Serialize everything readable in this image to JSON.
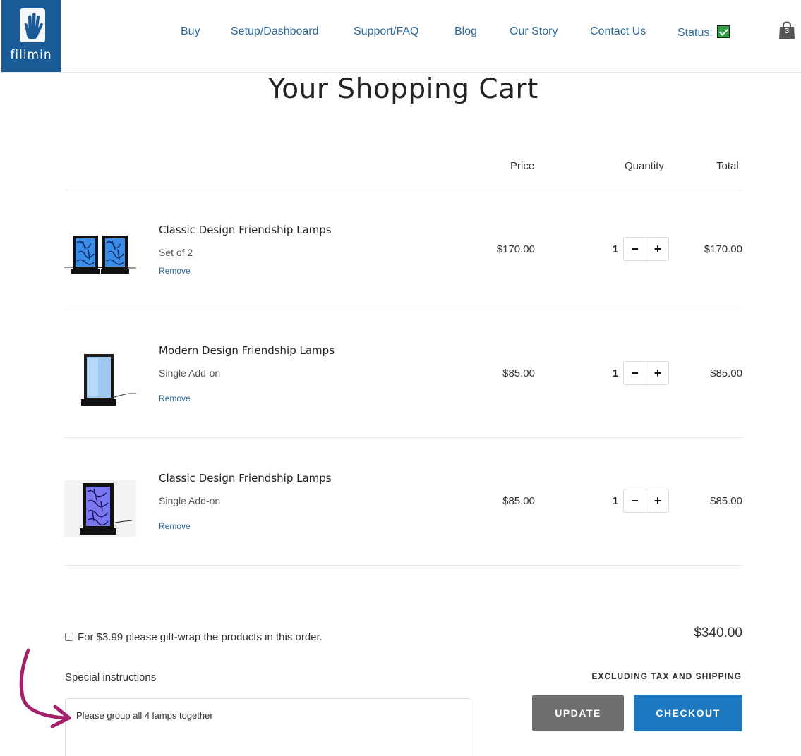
{
  "header": {
    "logo_text": "filimin",
    "nav": [
      {
        "label": "Buy"
      },
      {
        "label": "Setup/Dashboard"
      },
      {
        "label": "Support/FAQ"
      },
      {
        "label": "Blog"
      },
      {
        "label": "Our Story"
      },
      {
        "label": "Contact Us"
      },
      {
        "label": "Status:"
      }
    ],
    "status_color": "#2ea043",
    "cart_count": "3",
    "brand_color": "#1a5a96"
  },
  "page": {
    "title": "Your Shopping Cart"
  },
  "cart": {
    "columns": {
      "price": "Price",
      "quantity": "Quantity",
      "total": "Total"
    },
    "items": [
      {
        "name": "Classic Design Friendship Lamps",
        "variant": "Set of 2",
        "remove_label": "Remove",
        "price": "$170.00",
        "quantity": "1",
        "total": "$170.00",
        "thumb_icon": "classic-lamp-pair-image"
      },
      {
        "name": "Modern Design Friendship Lamps",
        "variant": "Single Add-on",
        "remove_label": "Remove",
        "price": "$85.00",
        "quantity": "1",
        "total": "$85.00",
        "thumb_icon": "modern-lamp-image"
      },
      {
        "name": "Classic Design Friendship Lamps",
        "variant": "Single Add-on",
        "remove_label": "Remove",
        "price": "$85.00",
        "quantity": "1",
        "total": "$85.00",
        "thumb_icon": "classic-lamp-image"
      }
    ],
    "qty_minus": "−",
    "qty_plus": "+"
  },
  "footer": {
    "gift_wrap_label": "For $3.99 please gift-wrap the products in this order.",
    "gift_wrap_checked": false,
    "subtotal": "$340.00",
    "tax_note": "EXCLUDING TAX AND SHIPPING",
    "instructions_label": "Special instructions",
    "instructions_value": "Please group all 4 lamps together",
    "update_label": "UPDATE",
    "checkout_label": "CHECKOUT",
    "update_color": "#6d6e70",
    "checkout_color": "#1d78bf",
    "annotation_arrow_color": "#a3206b"
  }
}
